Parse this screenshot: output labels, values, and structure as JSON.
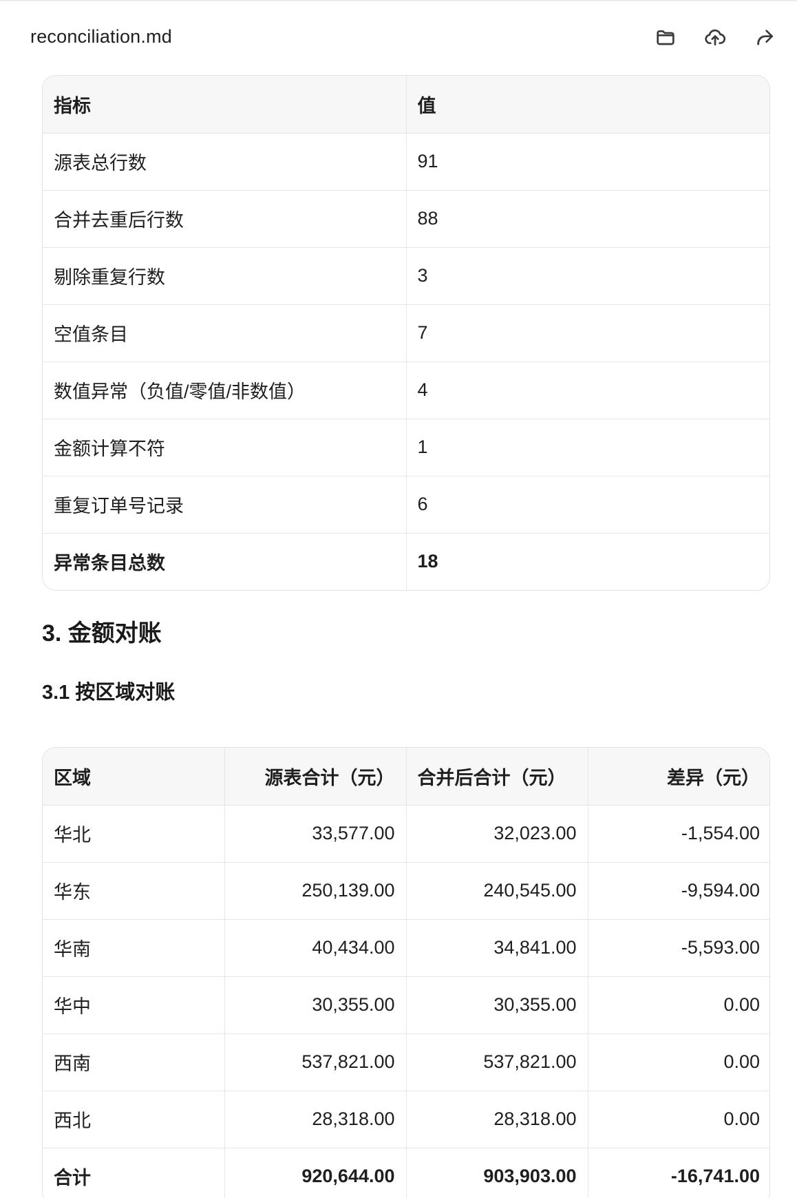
{
  "header": {
    "file_name": "reconciliation.md",
    "actions": [
      {
        "icon": "folder-icon",
        "label": "open-folder"
      },
      {
        "icon": "upload-icon",
        "label": "upload"
      },
      {
        "icon": "share-icon",
        "label": "share"
      }
    ]
  },
  "metrics_table": {
    "columns": [
      "指标",
      "值"
    ],
    "rows": [
      [
        "源表总行数",
        "91"
      ],
      [
        "合并去重后行数",
        "88"
      ],
      [
        "剔除重复行数",
        "3"
      ],
      [
        "空值条目",
        "7"
      ],
      [
        "数值异常（负值/零值/非数值）",
        "4"
      ],
      [
        "金额计算不符",
        "1"
      ],
      [
        "重复订单号记录",
        "6"
      ],
      [
        "异常条目总数",
        "18"
      ]
    ]
  },
  "section3": {
    "title": "3. 金额对账",
    "sub1": {
      "title": "3.1 按区域对账"
    }
  },
  "region_table": {
    "columns": [
      "区域",
      "源表合计（元）",
      "合并后合计（元）",
      "差异（元）"
    ],
    "rows": [
      [
        "华北",
        "33,577.00",
        "32,023.00",
        "-1,554.00"
      ],
      [
        "华东",
        "250,139.00",
        "240,545.00",
        "-9,594.00"
      ],
      [
        "华南",
        "40,434.00",
        "34,841.00",
        "-5,593.00"
      ],
      [
        "华中",
        "30,355.00",
        "30,355.00",
        "0.00"
      ],
      [
        "西南",
        "537,821.00",
        "537,821.00",
        "0.00"
      ],
      [
        "西北",
        "28,318.00",
        "28,318.00",
        "0.00"
      ],
      [
        "合计",
        "920,644.00",
        "903,903.00",
        "-16,741.00"
      ]
    ]
  }
}
